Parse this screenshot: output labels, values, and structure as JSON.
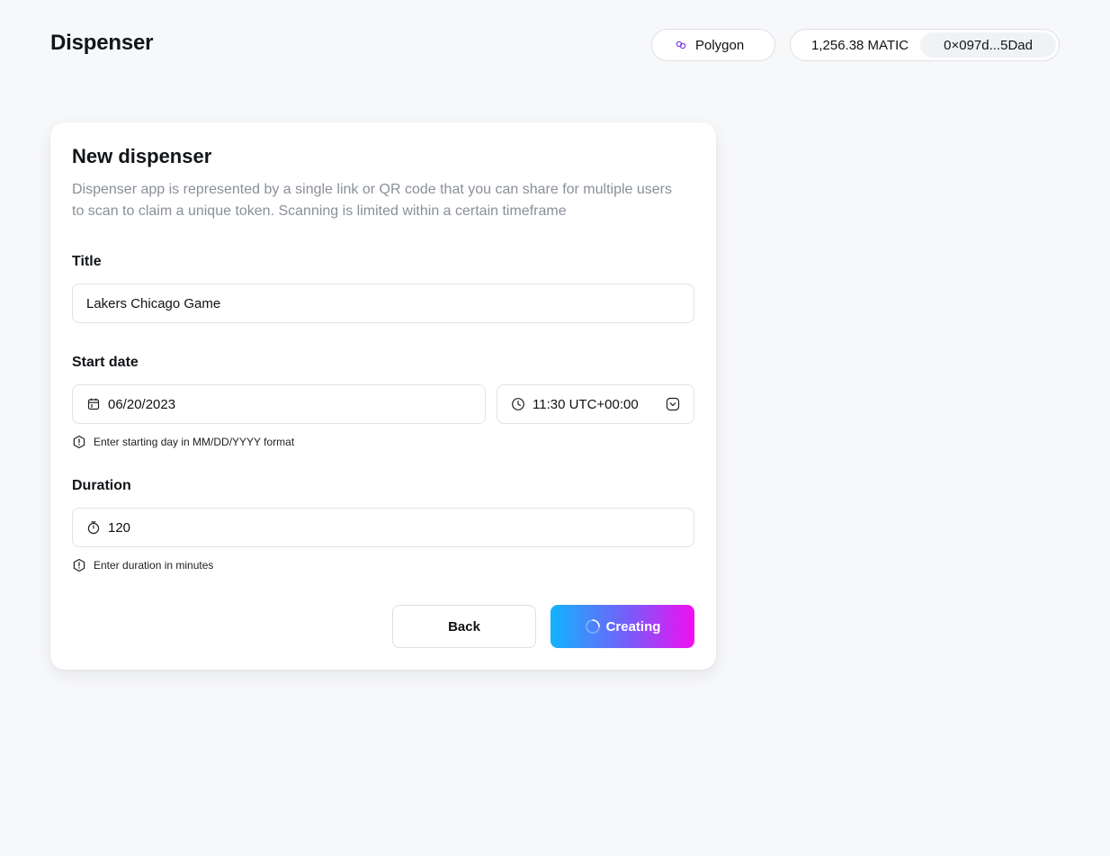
{
  "app": {
    "title": "Dispenser"
  },
  "header": {
    "network": {
      "label": "Polygon",
      "icon": "chain-link-icon",
      "icon_color": "#7b3fe4"
    },
    "account": {
      "balance": "1,256.38 MATIC",
      "address": "0×097d...5Dad"
    }
  },
  "form": {
    "title": "New dispenser",
    "description": "Dispenser app is represented by a single link or QR code that you can share for multiple users to scan to claim a unique token. Scanning is limited within a certain timeframe",
    "title_field": {
      "label": "Title",
      "value": "Lakers Chicago Game"
    },
    "start_date": {
      "label": "Start date",
      "date_value": "06/20/2023",
      "time_value": "11:30 UTC+00:00",
      "hint": "Enter starting day in MM/DD/YYYY format"
    },
    "duration": {
      "label": "Duration",
      "value": "120",
      "hint": "Enter duration in minutes"
    },
    "buttons": {
      "back": "Back",
      "create": "Creating"
    }
  },
  "colors": {
    "background": "#f7f8fa",
    "gradient_start": "#12b3ff",
    "gradient_end": "#f20ef2"
  }
}
